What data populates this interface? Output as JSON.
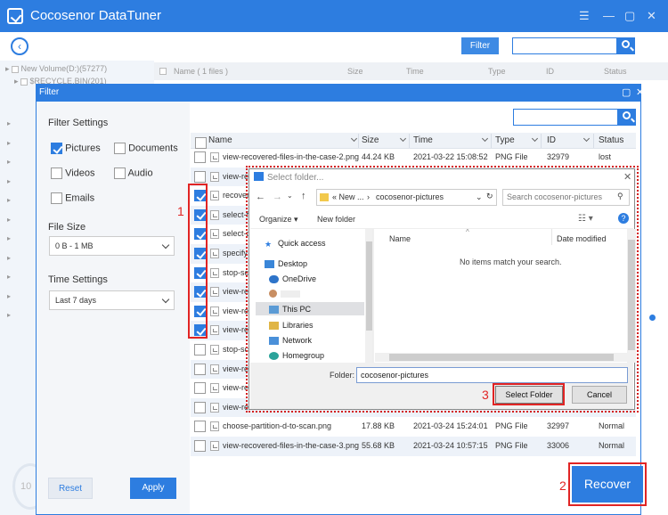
{
  "app": {
    "title": "Cocosenor DataTuner"
  },
  "toolbar": {
    "filter_label": "Filter",
    "search_value": ""
  },
  "tree": {
    "items": [
      "New Volume(D:)(57277)",
      "$RECYCLE.BIN(201)"
    ]
  },
  "main_list": {
    "name_header": "Name ( 1 files )",
    "size": "Size",
    "time": "Time",
    "type": "Type",
    "id": "ID",
    "status": "Status"
  },
  "progress": {
    "text": "10"
  },
  "filter": {
    "title": "Filter",
    "settings_title": "Filter Settings",
    "options": [
      {
        "label": "Pictures",
        "checked": true
      },
      {
        "label": "Documents",
        "checked": false
      },
      {
        "label": "Videos",
        "checked": false
      },
      {
        "label": "Audio",
        "checked": false
      },
      {
        "label": "Emails",
        "checked": false
      }
    ],
    "file_size_title": "File Size",
    "file_size_value": "0 B - 1 MB",
    "time_title": "Time Settings",
    "time_value": "Last 7 days",
    "reset_label": "Reset",
    "apply_label": "Apply",
    "search_value": ""
  },
  "file_list": {
    "headers": {
      "name": "Name",
      "size": "Size",
      "time": "Time",
      "type": "Type",
      "id": "ID",
      "status": "Status"
    },
    "rows": [
      {
        "name": "view-recovered-files-in-the-case-2.png",
        "size": "44.24 KB",
        "time": "2021-03-22 15:08:52",
        "type": "PNG File",
        "id": "32979",
        "status": "lost",
        "checked": false
      },
      {
        "name": "view-re",
        "size": "",
        "time": "",
        "type": "",
        "id": "",
        "status": "",
        "checked": false
      },
      {
        "name": "recover",
        "size": "",
        "time": "",
        "type": "",
        "id": "",
        "status": "",
        "checked": true
      },
      {
        "name": "select-f",
        "size": "",
        "time": "",
        "type": "",
        "id": "",
        "status": "",
        "checked": true
      },
      {
        "name": "select-p",
        "size": "",
        "time": "",
        "type": "",
        "id": "",
        "status": "",
        "checked": true
      },
      {
        "name": "specify",
        "size": "",
        "time": "",
        "type": "",
        "id": "",
        "status": "",
        "checked": true
      },
      {
        "name": "stop-sc",
        "size": "",
        "time": "",
        "type": "",
        "id": "",
        "status": "",
        "checked": true
      },
      {
        "name": "view-re",
        "size": "",
        "time": "",
        "type": "",
        "id": "",
        "status": "",
        "checked": true
      },
      {
        "name": "view-re",
        "size": "",
        "time": "",
        "type": "",
        "id": "",
        "status": "",
        "checked": true
      },
      {
        "name": "view-re",
        "size": "",
        "time": "",
        "type": "",
        "id": "",
        "status": "",
        "checked": true
      },
      {
        "name": "stop-sc",
        "size": "",
        "time": "",
        "type": "",
        "id": "",
        "status": "",
        "checked": false
      },
      {
        "name": "view-re",
        "size": "",
        "time": "",
        "type": "",
        "id": "",
        "status": "",
        "checked": false
      },
      {
        "name": "view-re",
        "size": "",
        "time": "",
        "type": "",
        "id": "",
        "status": "",
        "checked": false
      },
      {
        "name": "view-re",
        "size": "",
        "time": "",
        "type": "",
        "id": "",
        "status": "",
        "checked": false
      },
      {
        "name": "choose-partition-d-to-scan.png",
        "size": "17.88 KB",
        "time": "2021-03-24 15:24:01",
        "type": "PNG File",
        "id": "32997",
        "status": "Normal",
        "checked": false
      },
      {
        "name": "view-recovered-files-in-the-case-3.png",
        "size": "55.68 KB",
        "time": "2021-03-24 10:57:15",
        "type": "PNG File",
        "id": "33006",
        "status": "Normal",
        "checked": false
      }
    ]
  },
  "select_folder": {
    "title": "Select folder...",
    "path_prefix": "« New ...",
    "path_current": "cocosenor-pictures",
    "search_placeholder": "Search cocosenor-pictures",
    "organize_label": "Organize",
    "new_folder_label": "New folder",
    "nav_items": [
      "Quick access",
      "Desktop",
      "OneDrive",
      "",
      "This PC",
      "Libraries",
      "Network",
      "Homegroup"
    ],
    "col_name": "Name",
    "col_date": "Date modified",
    "empty_text": "No items match your search.",
    "folder_label": "Folder:",
    "folder_value": "cocosenor-pictures",
    "select_label": "Select Folder",
    "cancel_label": "Cancel"
  },
  "annotations": {
    "n1": "1",
    "n2": "2",
    "n3": "3"
  },
  "recover_label": "Recover",
  "colors": {
    "accent": "#2d7de0",
    "annotation": "#e12424"
  }
}
